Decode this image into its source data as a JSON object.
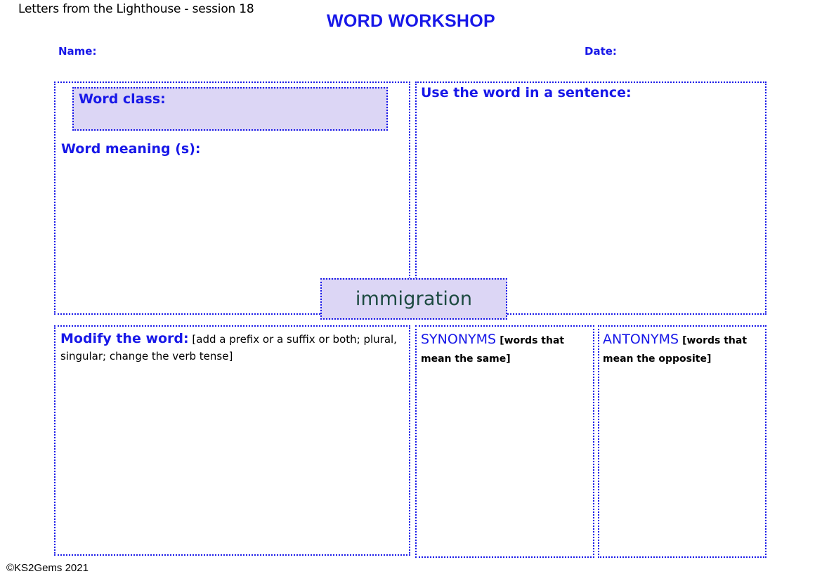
{
  "header": {
    "session_label": "Letters from the Lighthouse - session 18",
    "title": "WORD WORKSHOP",
    "name_label": "Name:",
    "date_label": "Date:"
  },
  "word_panel": {
    "word_class_label": "Word class:",
    "word_meaning_label": "Word meaning (s):"
  },
  "sentence_panel": {
    "label": "Use the word in a sentence:"
  },
  "focus_word": {
    "text": "immigration"
  },
  "modify_panel": {
    "heading": "Modify the word:",
    "instruction": "[add a prefix or a suffix or both; plural, singular; change the verb tense]"
  },
  "synonyms_panel": {
    "heading": "SYNONYMS",
    "instruction": "[words that mean the same]"
  },
  "antonyms_panel": {
    "heading": "ANTONYMS",
    "instruction": "[words that mean the opposite]"
  },
  "footer": {
    "copyright": "©KS2Gems 2021"
  },
  "colors": {
    "accent_blue": "#1818e8",
    "fill_lavender": "#dcd6f5",
    "word_text": "#1c4a40"
  }
}
